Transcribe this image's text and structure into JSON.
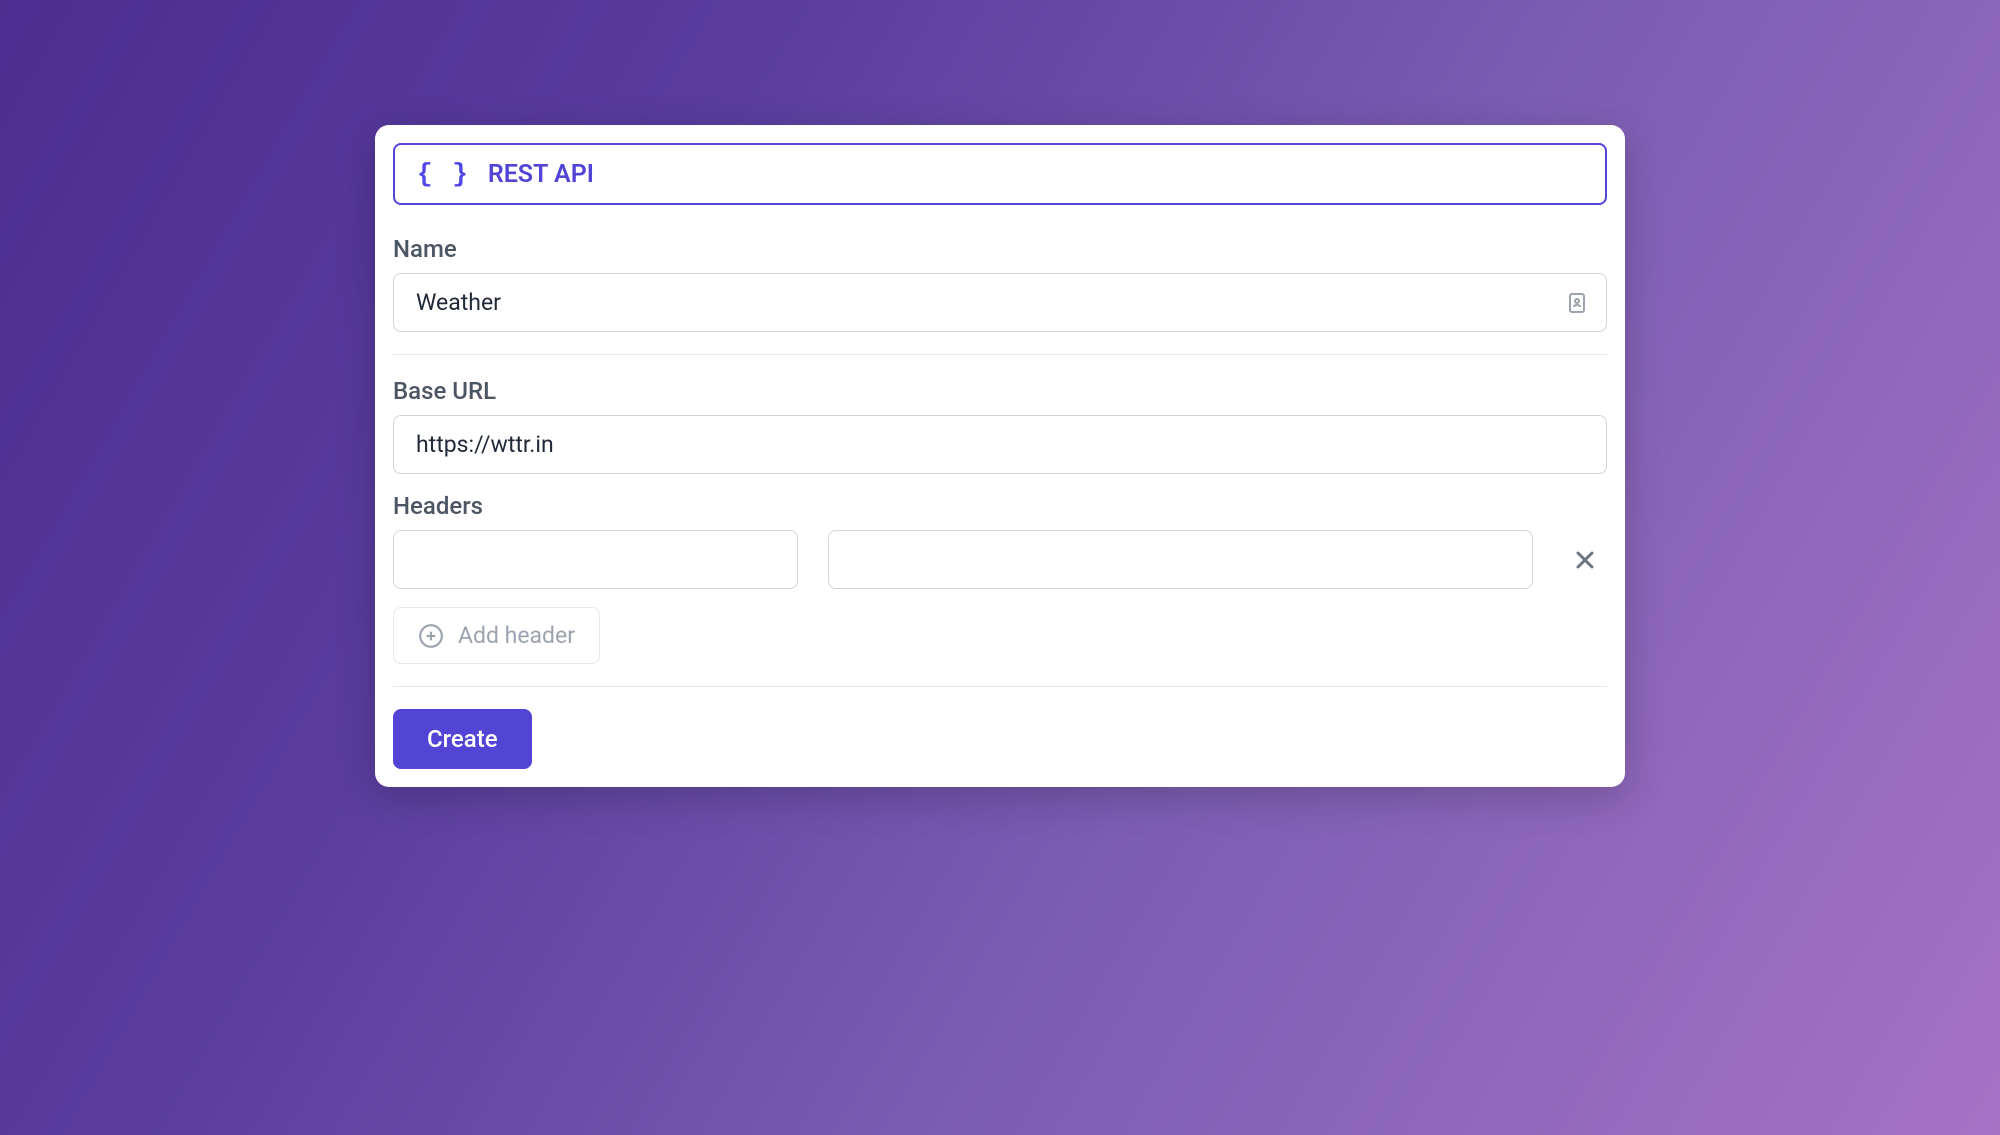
{
  "header": {
    "icon": "braces-icon",
    "title": "REST API"
  },
  "form": {
    "name": {
      "label": "Name",
      "value": "Weather"
    },
    "baseUrl": {
      "label": "Base URL",
      "value": "https://wttr.in"
    },
    "headers": {
      "label": "Headers",
      "rows": [
        {
          "key": "",
          "value": ""
        }
      ],
      "addButtonLabel": "Add header"
    },
    "submitLabel": "Create"
  }
}
